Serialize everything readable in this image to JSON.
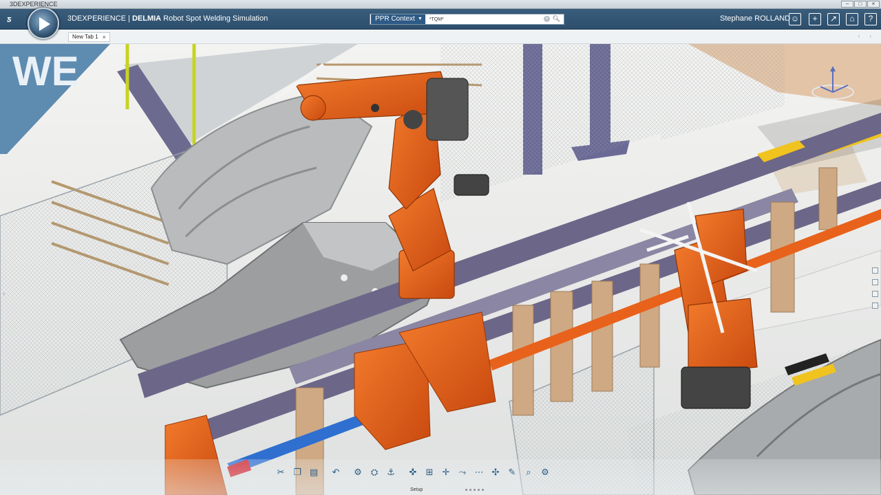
{
  "window": {
    "os_title": "3DEXPERIENCE"
  },
  "header": {
    "app_brand": "3DEXPERIENCE | ",
    "app_name": "DELMIA",
    "app_subtitle": " Robot Spot Welding Simulation",
    "search": {
      "context_label": "PPR Context",
      "value": "*TQM*"
    },
    "user_name": "Stephane ROLLAND"
  },
  "tabs": [
    {
      "label": "New Tab 1"
    }
  ],
  "action_bar": {
    "section_label": "Setup",
    "tools": [
      "scissors-icon",
      "copy-icon",
      "paste-icon",
      "undo-icon",
      "robot-icon",
      "device-icon",
      "anchor-icon",
      "gun-icon",
      "fixture-icon",
      "spot-icon",
      "path-icon",
      "dotted-path-icon",
      "compass-icon",
      "tool-icon",
      "magnifier-icon",
      "settings-icon"
    ]
  },
  "colors": {
    "header": "#2d4f6d",
    "accent": "#2d5a86",
    "robot": "#e8621c"
  }
}
